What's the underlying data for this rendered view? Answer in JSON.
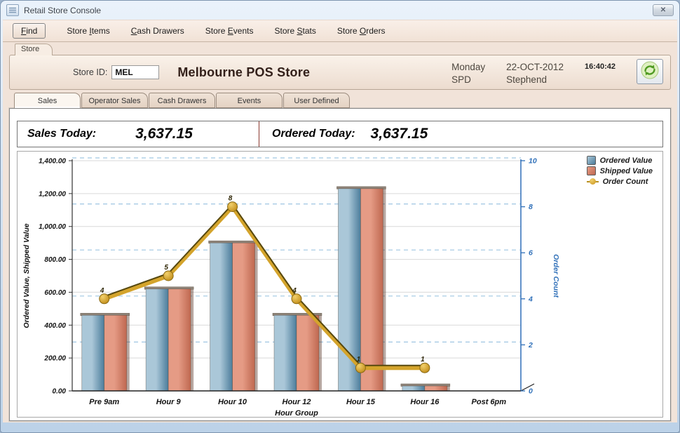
{
  "window": {
    "title": "Retail Store Console",
    "close_glyph": "✕"
  },
  "menubar": {
    "items": [
      {
        "id": "find",
        "pre": "",
        "key": "F",
        "post": "ind",
        "button": true
      },
      {
        "id": "store-items",
        "pre": "Store ",
        "key": "I",
        "post": "tems",
        "button": false
      },
      {
        "id": "cash-drawers",
        "pre": "",
        "key": "C",
        "post": "ash Drawers",
        "button": false
      },
      {
        "id": "store-events",
        "pre": "Store ",
        "key": "E",
        "post": "vents",
        "button": false
      },
      {
        "id": "store-stats",
        "pre": "Store ",
        "key": "S",
        "post": "tats",
        "button": false
      },
      {
        "id": "store-orders",
        "pre": "Store ",
        "key": "O",
        "post": "rders",
        "button": false
      }
    ]
  },
  "store_header": {
    "group_label": "Store",
    "store_id_label": "Store ID:",
    "store_id_value": "MEL",
    "store_name": "Melbourne POS Store",
    "day": "Monday",
    "code": "SPD",
    "date": "22-OCT-2012",
    "user": "Stephend",
    "time": "16:40:42"
  },
  "tabs": [
    {
      "label": "Sales",
      "active": true
    },
    {
      "label": "Operator Sales",
      "active": false
    },
    {
      "label": "Cash Drawers",
      "active": false
    },
    {
      "label": "Events",
      "active": false
    },
    {
      "label": "User Defined",
      "active": false
    }
  ],
  "summary": {
    "sales_label": "Sales Today:",
    "sales_value": "3,637.15",
    "ordered_label": "Ordered Today:",
    "ordered_value": "3,637.15"
  },
  "chart_data": {
    "type": "bar",
    "subtype": "grouped-bars-with-line",
    "categories": [
      "Pre 9am",
      "Hour  9",
      "Hour 10",
      "Hour 12",
      "Hour 15",
      "Hour 16",
      "Post 6pm"
    ],
    "series": [
      {
        "name": "Ordered Value",
        "type": "bar",
        "axis": "left",
        "color_light": "#aac7d8",
        "color_dark": "#4c7d9b",
        "values": [
          460,
          620,
          900,
          460,
          1230,
          30,
          0
        ]
      },
      {
        "name": "Shipped Value",
        "type": "bar",
        "axis": "left",
        "color_light": "#e59b85",
        "color_dark": "#bf6850",
        "values": [
          460,
          620,
          900,
          460,
          1230,
          30,
          0
        ]
      },
      {
        "name": "Order Count",
        "type": "line",
        "axis": "right",
        "color": "#d4a42c",
        "edge_color": "#56480f",
        "values": [
          4,
          5,
          8,
          4,
          1,
          1,
          null
        ]
      }
    ],
    "left_axis": {
      "label": "Ordered Value, Shipped Value",
      "min": 0,
      "max": 1400,
      "step": 200
    },
    "right_axis": {
      "label": "Order Count",
      "min": 0,
      "max": 10,
      "step": 2,
      "color": "#2e6fb8"
    },
    "xlabel": "Hour Group",
    "grid": {
      "left_color": "#d9d9d9",
      "right_color": "#9fc6e2",
      "right_dashed": true
    },
    "legend_position": "top-right"
  }
}
